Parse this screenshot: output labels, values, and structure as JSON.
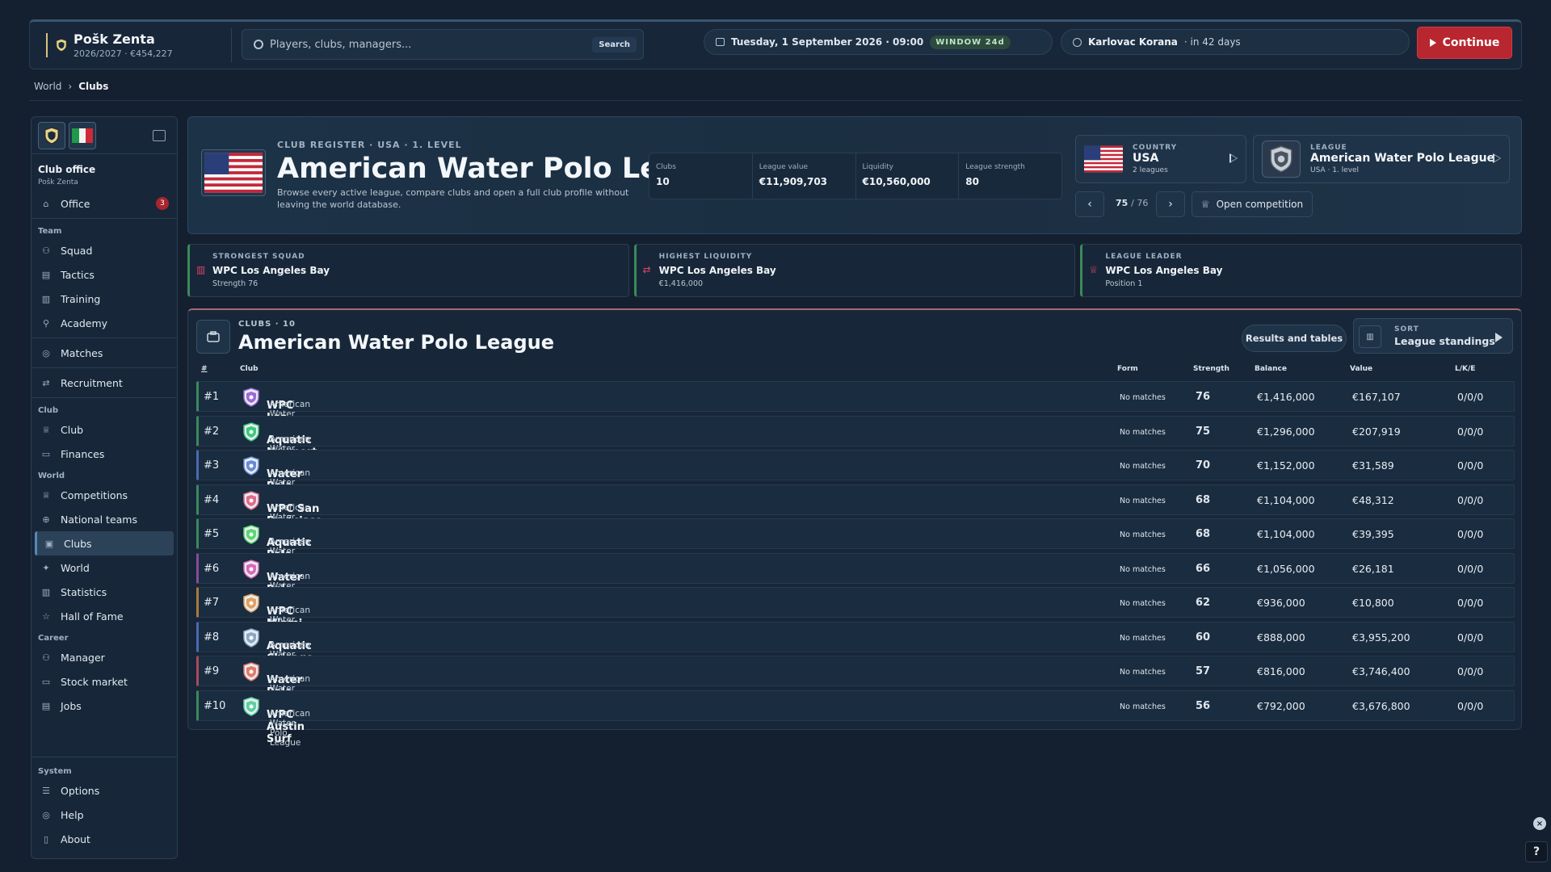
{
  "topbar": {
    "club_name": "Pošk Zenta",
    "club_sub": "2026/2027 · €454,227",
    "search_placeholder": "Players, clubs, managers...",
    "search_button": "Search",
    "date": "Tuesday, 1 September 2026 · 09:00",
    "window_badge": "WINDOW 24d",
    "next_opponent": "Karlovac Korana",
    "next_in": "· in 42 days",
    "continue_label": "Continue"
  },
  "breadcrumb": {
    "root": "World",
    "current": "Clubs"
  },
  "sidebar": {
    "office_title": "Club office",
    "office_sub": "Pošk Zenta",
    "office_label": "Office",
    "office_badge": "3",
    "sec_team": "Team",
    "squad": "Squad",
    "tactics": "Tactics",
    "training": "Training",
    "academy": "Academy",
    "matches": "Matches",
    "recruitment": "Recruitment",
    "sec_club": "Club",
    "club": "Club",
    "finances": "Finances",
    "sec_world": "World",
    "competitions": "Competitions",
    "national_teams": "National teams",
    "clubs": "Clubs",
    "world": "World",
    "statistics": "Statistics",
    "hall_of_fame": "Hall of Fame",
    "sec_career": "Career",
    "manager": "Manager",
    "stock_market": "Stock market",
    "jobs": "Jobs",
    "sec_system": "System",
    "options": "Options",
    "help": "Help",
    "about": "About"
  },
  "hero": {
    "eyebrow": "CLUB REGISTER · USA · 1. LEVEL",
    "title": "American Water Polo League",
    "description": "Browse every active league, compare clubs and open a full club profile without leaving the world database.",
    "stats": [
      {
        "label": "Clubs",
        "value": "10"
      },
      {
        "label": "League value",
        "value": "€11,909,703"
      },
      {
        "label": "Liquidity",
        "value": "€10,560,000"
      },
      {
        "label": "League strength",
        "value": "80"
      }
    ],
    "country_label": "COUNTRY",
    "country_value": "USA",
    "country_sub": "2 leagues",
    "league_label": "LEAGUE",
    "league_value": "American Water Polo League",
    "league_sub": "USA · 1. level",
    "pager_current": "75",
    "pager_total": "/ 76",
    "open_competition": "Open competition"
  },
  "kpis": [
    {
      "label": "STRONGEST SQUAD",
      "value": "WPC Los Angeles Bay",
      "sub": "Strength 76"
    },
    {
      "label": "HIGHEST LIQUIDITY",
      "value": "WPC Los Angeles Bay",
      "sub": "€1,416,000"
    },
    {
      "label": "LEAGUE LEADER",
      "value": "WPC Los Angeles Bay",
      "sub": "Position 1"
    }
  ],
  "clubs_panel": {
    "eyebrow": "CLUBS · 10",
    "title": "American Water Polo League",
    "results_button": "Results and tables",
    "sort_label": "SORT",
    "sort_value": "League standings",
    "headers": {
      "rank": "#",
      "club": "Club",
      "form": "Form",
      "strength": "Strength",
      "balance": "Balance",
      "value": "Value",
      "lke": "L/K/E"
    },
    "rows": [
      {
        "rank": "#1",
        "name": "WPC Los Angeles Bay",
        "league": "American Water Polo League",
        "form": "No matches",
        "strength": "76",
        "balance": "€1,416,000",
        "value": "€167,107",
        "lke": "0/0/0"
      },
      {
        "rank": "#2",
        "name": "Aquatic Newport Beach Surf",
        "league": "American Water Polo League",
        "form": "No matches",
        "strength": "75",
        "balance": "€1,296,000",
        "value": "€207,919",
        "lke": "0/0/0"
      },
      {
        "rank": "#3",
        "name": "Water Polo San Diego Harbor",
        "league": "American Water Polo League",
        "form": "No matches",
        "strength": "70",
        "balance": "€1,152,000",
        "value": "€31,589",
        "lke": "0/0/0"
      },
      {
        "rank": "#4",
        "name": "WPC San Francisco Tritons",
        "league": "American Water Polo League",
        "form": "No matches",
        "strength": "68",
        "balance": "€1,104,000",
        "value": "€48,312",
        "lke": "0/0/0"
      },
      {
        "rank": "#5",
        "name": "Aquatic Palo Alto Bay",
        "league": "American Water Polo League",
        "form": "No matches",
        "strength": "68",
        "balance": "€1,104,000",
        "value": "€39,395",
        "lke": "0/0/0"
      },
      {
        "rank": "#6",
        "name": "Water Polo New York Surf",
        "league": "American Water Polo League",
        "form": "No matches",
        "strength": "66",
        "balance": "€1,056,000",
        "value": "€26,181",
        "lke": "0/0/0"
      },
      {
        "rank": "#7",
        "name": "WPC Miami Harbor",
        "league": "American Water Polo League",
        "form": "No matches",
        "strength": "62",
        "balance": "€936,000",
        "value": "€10,800",
        "lke": "0/0/0"
      },
      {
        "rank": "#8",
        "name": "Aquatic Chicago Tritons",
        "league": "American Water Polo League",
        "form": "No matches",
        "strength": "60",
        "balance": "€888,000",
        "value": "€3,955,200",
        "lke": "0/0/0"
      },
      {
        "rank": "#9",
        "name": "Water Polo Boston Bay",
        "league": "American Water Polo League",
        "form": "No matches",
        "strength": "57",
        "balance": "€816,000",
        "value": "€3,746,400",
        "lke": "0/0/0"
      },
      {
        "rank": "#10",
        "name": "WPC Austin Surf",
        "league": "American Water Polo League",
        "form": "No matches",
        "strength": "56",
        "balance": "€792,000",
        "value": "€3,676,800",
        "lke": "0/0/0"
      }
    ]
  },
  "colors": {
    "accent_red": "#b8262f",
    "row_green": "#3a8a5a",
    "active_blue": "#5a86b8"
  },
  "help_label": "?"
}
